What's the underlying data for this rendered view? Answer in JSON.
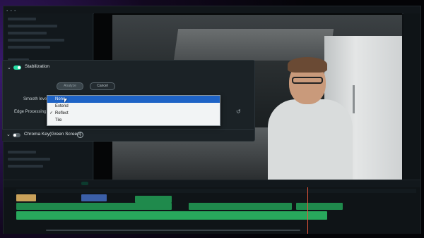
{
  "colors": {
    "accent": "#27e0a6",
    "selection": "#1e63c6",
    "playhead": "#e7553b"
  },
  "stabilization": {
    "title": "Stabilization",
    "enabled": true,
    "analyze_label": "Analyze",
    "cancel_label": "Cancel",
    "smooth_level_label": "Smooth level:",
    "edge_processing_label": "Edge Processing:",
    "edge_processing_value": "Reflect"
  },
  "dropdown": {
    "options": [
      {
        "label": "None",
        "selected": true,
        "checked": false
      },
      {
        "label": "Extend",
        "selected": false,
        "checked": false
      },
      {
        "label": "Reflect",
        "selected": false,
        "checked": true
      },
      {
        "label": "Tile",
        "selected": false,
        "checked": false
      }
    ]
  },
  "chroma_key": {
    "title": "Chroma Key(Green Screen)",
    "enabled": false
  },
  "icons": {
    "check": "✓",
    "chevron": "⌄",
    "reset": "↺",
    "help": "?"
  }
}
